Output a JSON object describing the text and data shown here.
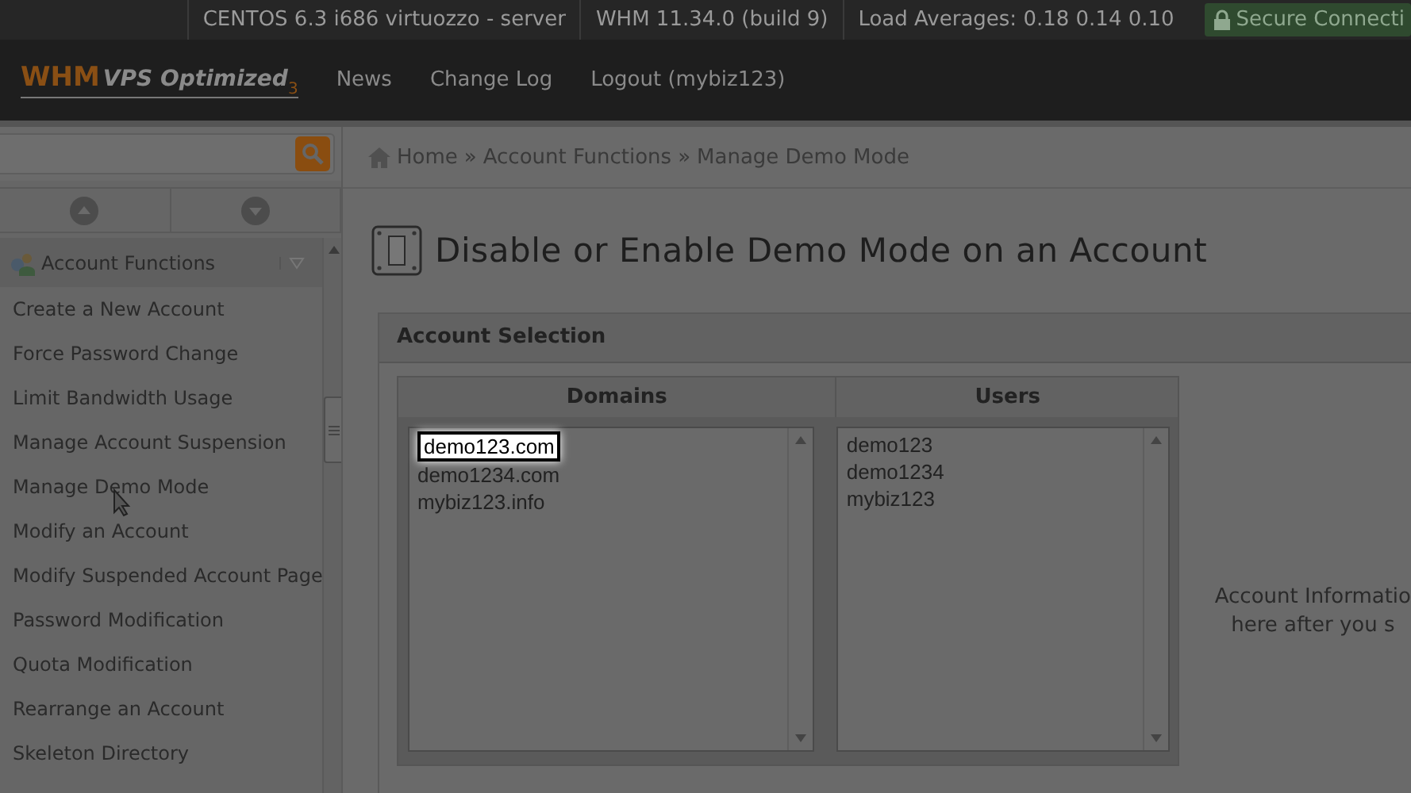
{
  "status_bar": {
    "items": [
      "CENTOS 6.3 i686 virtuozzo - server",
      "WHM 11.34.0 (build 9)",
      "Load Averages: 0.18 0.14 0.10"
    ],
    "secure": "Secure Connecti"
  },
  "header": {
    "logo": {
      "main": "WHM",
      "sub": "VPS Optimized",
      "version": "3"
    },
    "nav": [
      "News",
      "Change Log",
      "Logout (mybiz123)"
    ]
  },
  "sidebar": {
    "group": {
      "label": "Account Functions",
      "expanded": true
    },
    "items": [
      "Create a New Account",
      "Force Password Change",
      "Limit Bandwidth Usage",
      "Manage Account Suspension",
      "Manage Demo Mode",
      "Modify an Account",
      "Modify Suspended Account Page",
      "Password Modification",
      "Quota Modification",
      "Rearrange an Account",
      "Skeleton Directory"
    ]
  },
  "breadcrumb": {
    "items": [
      "Home",
      "Account Functions",
      "Manage Demo Mode"
    ],
    "separator": "»"
  },
  "title": "Disable or Enable Demo Mode on an Account",
  "panel": {
    "title": "Account Selection",
    "columns": [
      "Domains",
      "Users"
    ],
    "domains": [
      {
        "label": "demo123.com",
        "selected": true
      },
      {
        "label": "demo1234.com",
        "selected": false
      },
      {
        "label": "mybiz123.info",
        "selected": false
      }
    ],
    "users": [
      {
        "label": "demo123",
        "selected": false
      },
      {
        "label": "demo1234",
        "selected": false
      },
      {
        "label": "mybiz123",
        "selected": false
      }
    ],
    "info": [
      "Account Informatio",
      "here after you s"
    ]
  }
}
